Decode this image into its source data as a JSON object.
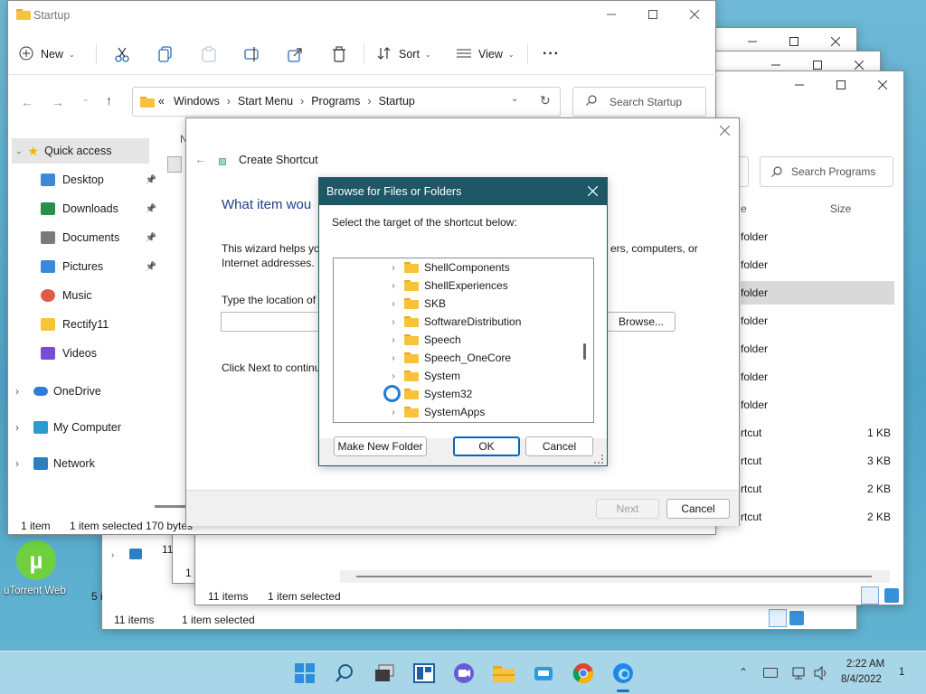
{
  "desktop": {
    "utorrent_label": "uTorrent Web"
  },
  "explorer_main": {
    "title": "Startup",
    "toolbar": {
      "new_label": "New",
      "sort_label": "Sort",
      "view_label": "View"
    },
    "address": {
      "prefix": "«",
      "crumbs": [
        "Windows",
        "Start Menu",
        "Programs",
        "Startup"
      ]
    },
    "search_placeholder": "Search Startup",
    "column_header_partial": "N",
    "sidebar": {
      "quick_access": "Quick access",
      "items": [
        {
          "label": "Desktop",
          "pinned": true
        },
        {
          "label": "Downloads",
          "pinned": true
        },
        {
          "label": "Documents",
          "pinned": true
        },
        {
          "label": "Pictures",
          "pinned": true
        },
        {
          "label": "Music",
          "pinned": false
        },
        {
          "label": "Rectify11",
          "pinned": false
        },
        {
          "label": "Videos",
          "pinned": false
        }
      ],
      "roots": [
        "OneDrive",
        "My Computer",
        "Network"
      ]
    },
    "status": {
      "count": "1 item",
      "selected": "1 item selected",
      "size": "170 bytes"
    }
  },
  "explorer_back": {
    "search_placeholder": "Search Programs",
    "column_size": "Size",
    "column_type_partial": "e",
    "rows": [
      {
        "type": "folder",
        "size": ""
      },
      {
        "type": "folder",
        "size": ""
      },
      {
        "type": "folder",
        "size": ""
      },
      {
        "type": "folder",
        "size": ""
      },
      {
        "type": "folder",
        "size": ""
      },
      {
        "type": "folder",
        "size": ""
      },
      {
        "type": "folder",
        "size": ""
      },
      {
        "type": "rtcut",
        "size": "1 KB"
      },
      {
        "type": "rtcut",
        "size": "3 KB"
      },
      {
        "type": "rtcut",
        "size": "2 KB"
      },
      {
        "type": "rtcut",
        "size": "2 KB"
      }
    ],
    "status_count": "11 items",
    "status_selected": "1 item selected"
  },
  "explorer_back2": {
    "status_count": "11 items",
    "status_selected": "1 item selected",
    "partial_5": "5 i",
    "partial_11": "11",
    "partial_1": "1 i"
  },
  "wizard": {
    "title": "Create Shortcut",
    "heading": "What item wou",
    "desc_line1_left": "This wizard helps you",
    "desc_line1_right": "ers, computers, or",
    "desc_line2": "Internet addresses.",
    "location_label": "Type the location of t",
    "browse_label": "Browse...",
    "next_hint": "Click Next to continu",
    "next_button": "Next",
    "cancel_button": "Cancel"
  },
  "browse_dialog": {
    "title": "Browse for Files or Folders",
    "instruction": "Select the target of the shortcut below:",
    "folders": [
      "ShellComponents",
      "ShellExperiences",
      "SKB",
      "SoftwareDistribution",
      "Speech",
      "Speech_OneCore",
      "System",
      "System32",
      "SystemApps"
    ],
    "make_new_folder": "Make New Folder",
    "ok": "OK",
    "cancel": "Cancel"
  },
  "taskbar": {
    "time": "2:22 AM",
    "date": "8/4/2022",
    "notif_count": "1"
  },
  "colors": {
    "dialog_title_bg": "#1e5766",
    "accent": "#0067c0",
    "folder": "#f8c23a"
  }
}
